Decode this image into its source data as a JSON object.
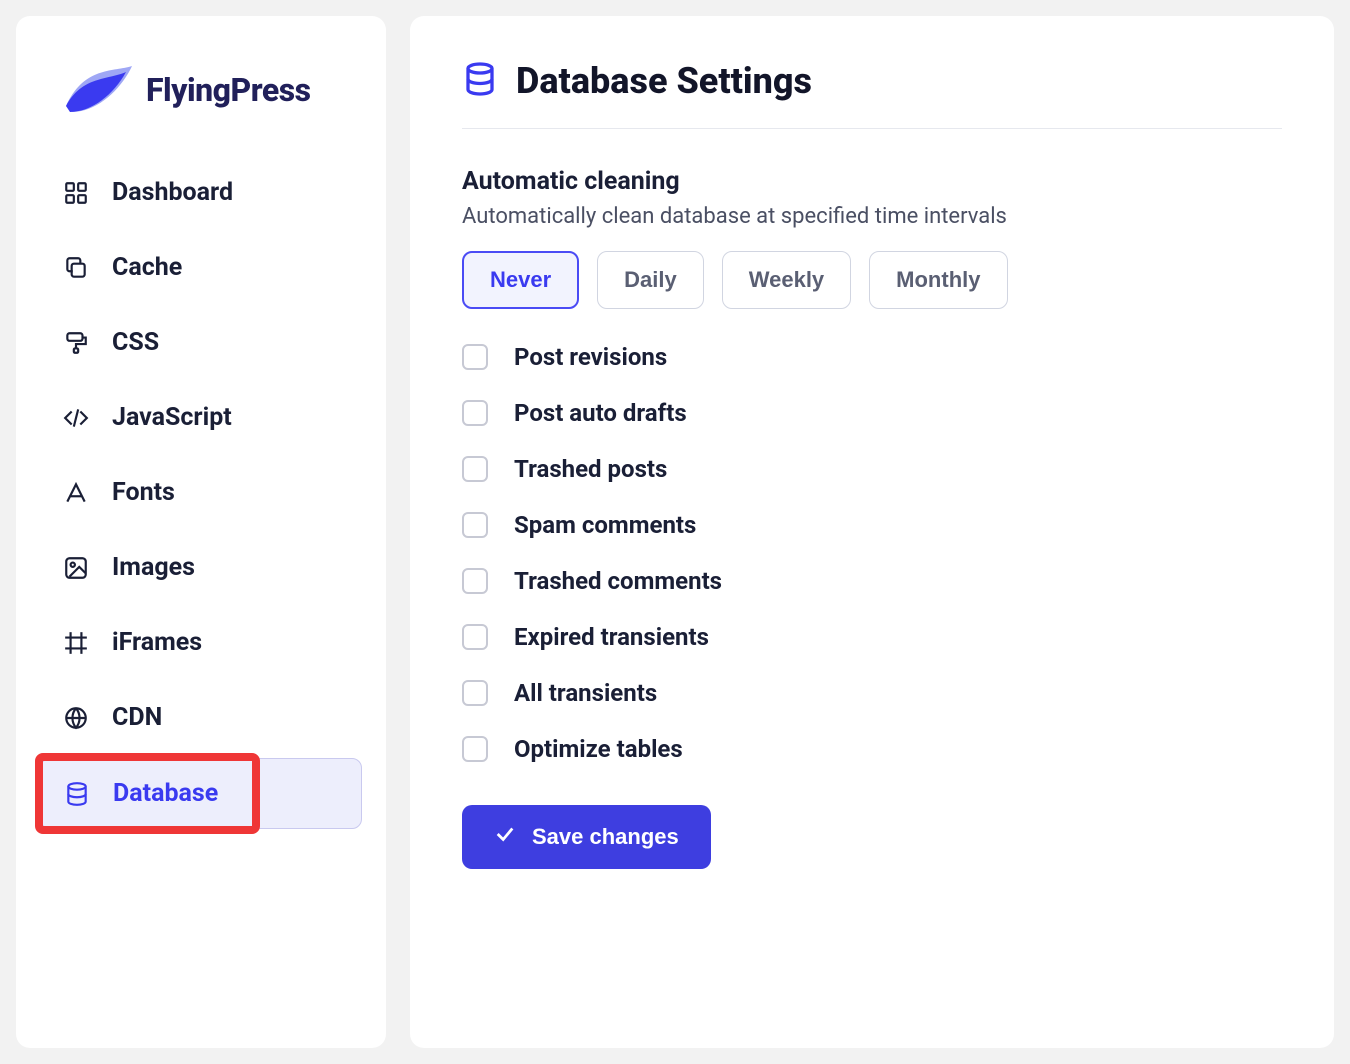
{
  "brand": "FlyingPress",
  "sidebar": {
    "items": [
      {
        "label": "Dashboard",
        "icon": "grid-icon",
        "active": false
      },
      {
        "label": "Cache",
        "icon": "copy-icon",
        "active": false
      },
      {
        "label": "CSS",
        "icon": "paint-icon",
        "active": false
      },
      {
        "label": "JavaScript",
        "icon": "code-icon",
        "active": false
      },
      {
        "label": "Fonts",
        "icon": "font-icon",
        "active": false
      },
      {
        "label": "Images",
        "icon": "image-icon",
        "active": false
      },
      {
        "label": "iFrames",
        "icon": "frame-icon",
        "active": false
      },
      {
        "label": "CDN",
        "icon": "globe-icon",
        "active": false
      },
      {
        "label": "Database",
        "icon": "database-icon",
        "active": true
      }
    ]
  },
  "page": {
    "title": "Database Settings",
    "section_title": "Automatic cleaning",
    "section_desc": "Automatically clean database at specified time intervals",
    "intervals": [
      {
        "label": "Never",
        "selected": true
      },
      {
        "label": "Daily",
        "selected": false
      },
      {
        "label": "Weekly",
        "selected": false
      },
      {
        "label": "Monthly",
        "selected": false
      }
    ],
    "options": [
      {
        "label": "Post revisions",
        "checked": false
      },
      {
        "label": "Post auto drafts",
        "checked": false
      },
      {
        "label": "Trashed posts",
        "checked": false
      },
      {
        "label": "Spam comments",
        "checked": false
      },
      {
        "label": "Trashed comments",
        "checked": false
      },
      {
        "label": "Expired transients",
        "checked": false
      },
      {
        "label": "All transients",
        "checked": false
      },
      {
        "label": "Optimize tables",
        "checked": false
      }
    ],
    "save_label": "Save changes"
  }
}
